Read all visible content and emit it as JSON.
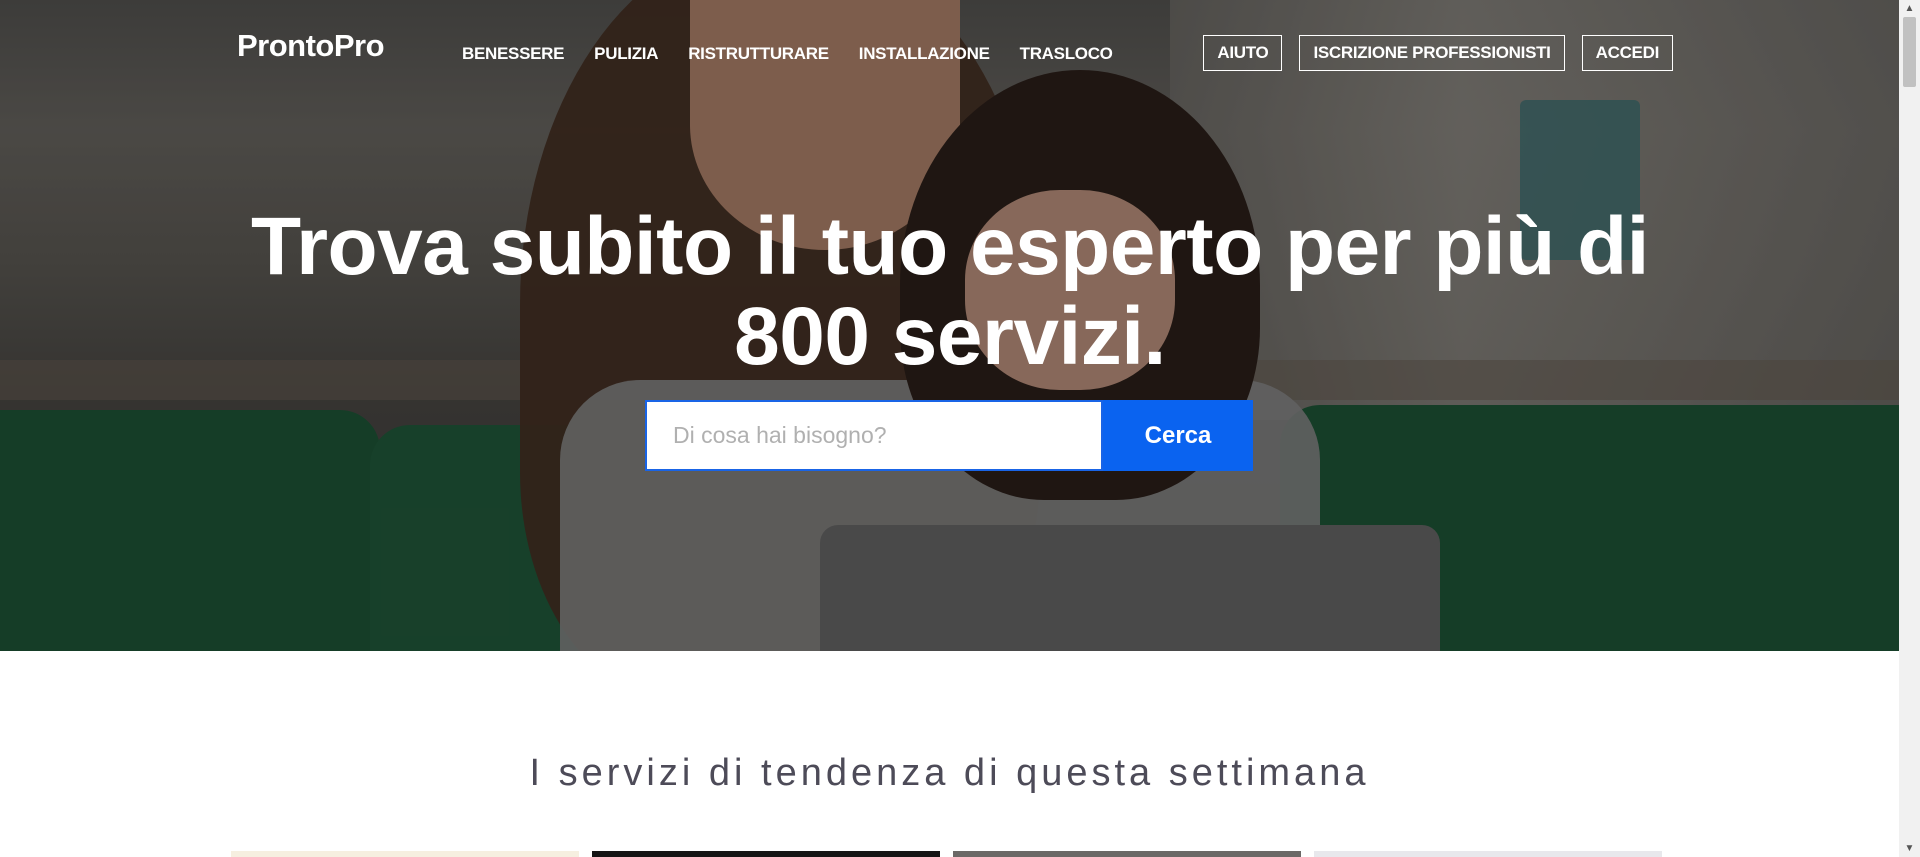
{
  "header": {
    "logo": "ProntoPro",
    "nav": [
      "BENESSERE",
      "PULIZIA",
      "RISTRUTTURARE",
      "INSTALLAZIONE",
      "TRASLOCO"
    ],
    "buttons": [
      "AIUTO",
      "ISCRIZIONE PROFESSIONISTI",
      "ACCEDI"
    ]
  },
  "hero": {
    "headline": "Trova subito il tuo esperto per più di 800 servizi.",
    "search": {
      "placeholder": "Di cosa hai bisogno?",
      "value": "",
      "button": "Cerca"
    }
  },
  "trending": {
    "title": "I servizi di tendenza di questa settimana",
    "card_colors": [
      "#f6efe0",
      "#151515",
      "#6b6866",
      "#e8e8ec"
    ]
  },
  "colors": {
    "accent": "#0a63f0",
    "search_border": "#1964e6",
    "section_title": "#4d4b58"
  },
  "icons": {
    "scroll_up": "triangle-up-icon",
    "scroll_down": "triangle-down-icon"
  }
}
